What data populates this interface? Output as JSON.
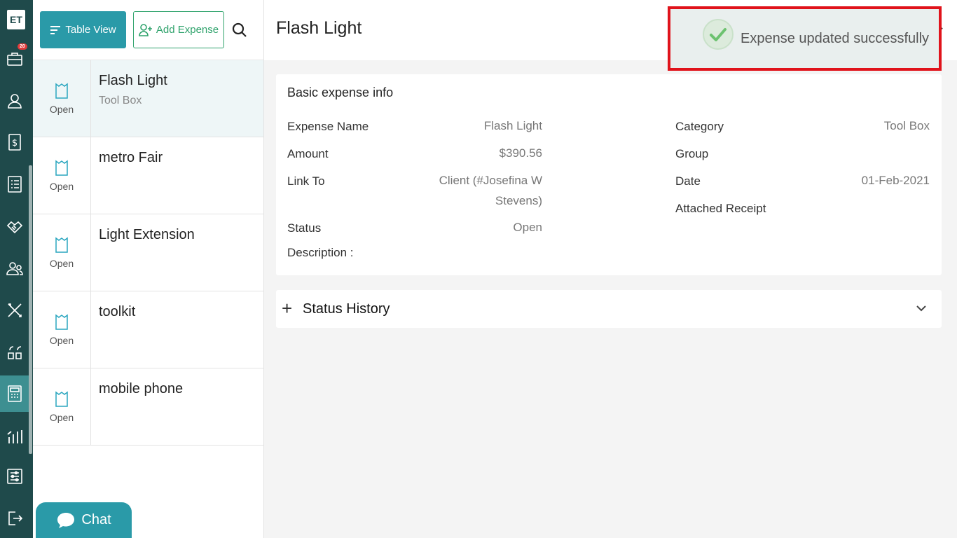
{
  "app": {
    "logo": "ET",
    "notification_count": "20"
  },
  "sidebar": {
    "items": [
      {
        "name": "briefcase-icon"
      },
      {
        "name": "user-icon"
      },
      {
        "name": "dollar-icon"
      },
      {
        "name": "list-icon"
      },
      {
        "name": "handshake-icon"
      },
      {
        "name": "users-icon"
      },
      {
        "name": "tools-icon"
      },
      {
        "name": "quote-icon"
      },
      {
        "name": "calculator-icon",
        "active": true
      },
      {
        "name": "chart-icon"
      },
      {
        "name": "settings-sliders-icon"
      },
      {
        "name": "logout-icon"
      }
    ]
  },
  "toolbar": {
    "table_view_label": "Table View",
    "add_expense_label": "Add Expense"
  },
  "expenses": [
    {
      "title": "Flash Light",
      "sub": "Tool Box",
      "state": "Open"
    },
    {
      "title": "metro Fair",
      "sub": "",
      "state": "Open"
    },
    {
      "title": "Light Extension",
      "sub": "",
      "state": "Open"
    },
    {
      "title": "toolkit",
      "sub": "",
      "state": "Open"
    },
    {
      "title": "mobile phone",
      "sub": "",
      "state": "Open"
    }
  ],
  "chat": {
    "label": "Chat"
  },
  "main": {
    "title": "Flash Light",
    "basic_info": {
      "heading": "Basic expense info",
      "expense_name_label": "Expense Name",
      "expense_name_value": "Flash Light",
      "amount_label": "Amount",
      "amount_value": "$390.56",
      "link_to_label": "Link To",
      "link_to_value_line1": "Client (#Josefina W",
      "link_to_value_line2": "Stevens)",
      "status_label": "Status",
      "status_value": "Open",
      "description_label": "Description  :",
      "category_label": "Category",
      "category_value": "Tool Box",
      "group_label": "Group",
      "date_label": "Date",
      "date_value": "01-Feb-2021",
      "receipt_label": "Attached Receipt"
    },
    "status_history": {
      "heading": "Status History"
    }
  },
  "toast": {
    "message": "Expense updated successfully"
  },
  "colors": {
    "rail": "#1f4a4b",
    "accent": "#2a9aa8",
    "green": "#2ea26b",
    "highlight": "#e0131b"
  }
}
